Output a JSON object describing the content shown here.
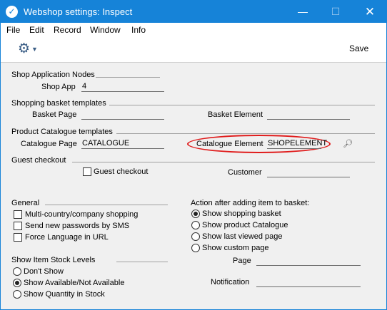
{
  "window": {
    "title": "Webshop settings: Inspect",
    "controls": {
      "minimize": "—",
      "maximize": "☐",
      "close": "✕"
    }
  },
  "menu": {
    "items": [
      "File",
      "Edit",
      "Record",
      "Window",
      "Info"
    ]
  },
  "toolbar": {
    "save_label": "Save",
    "gear_icon": "gear-icon"
  },
  "shop_app_nodes": {
    "title": "Shop Application Nodes",
    "shop_app_label": "Shop App",
    "shop_app_value": "4"
  },
  "shopping_basket": {
    "title": "Shopping basket templates",
    "basket_page_label": "Basket Page",
    "basket_page_value": "",
    "basket_element_label": "Basket Element",
    "basket_element_value": ""
  },
  "product_catalogue": {
    "title": "Product Catalogue templates",
    "catalogue_page_label": "Catalogue Page",
    "catalogue_page_value": "CATALOGUE",
    "catalogue_element_label": "Catalogue Element",
    "catalogue_element_value": "SHOPELEMENT",
    "highlight_color": "#e01b1b"
  },
  "guest_checkout": {
    "title": "Guest checkout",
    "checkbox_label": "Guest checkout",
    "checked": false,
    "customer_label": "Customer",
    "customer_value": ""
  },
  "general": {
    "title": "General",
    "options": [
      {
        "label": "Multi-country/company shopping",
        "checked": false
      },
      {
        "label": "Send new passwords by SMS",
        "checked": false
      },
      {
        "label": "Force Language in URL",
        "checked": false
      }
    ]
  },
  "action_after_adding": {
    "title": "Action after adding item to basket:",
    "options": [
      {
        "label": "Show shopping basket",
        "selected": true
      },
      {
        "label": "Show product Catalogue",
        "selected": false
      },
      {
        "label": "Show last viewed page",
        "selected": false
      },
      {
        "label": "Show custom page",
        "selected": false
      }
    ],
    "page_label": "Page",
    "page_value": "",
    "notification_label": "Notification",
    "notification_value": ""
  },
  "stock_levels": {
    "title": "Show Item Stock Levels",
    "options": [
      {
        "label": "Don't Show",
        "selected": false
      },
      {
        "label": "Show Available/Not Available",
        "selected": true
      },
      {
        "label": "Show Quantity in Stock",
        "selected": false
      }
    ]
  },
  "colors": {
    "titlebar": "#1683d8",
    "accent_gear": "#3b5e86"
  }
}
